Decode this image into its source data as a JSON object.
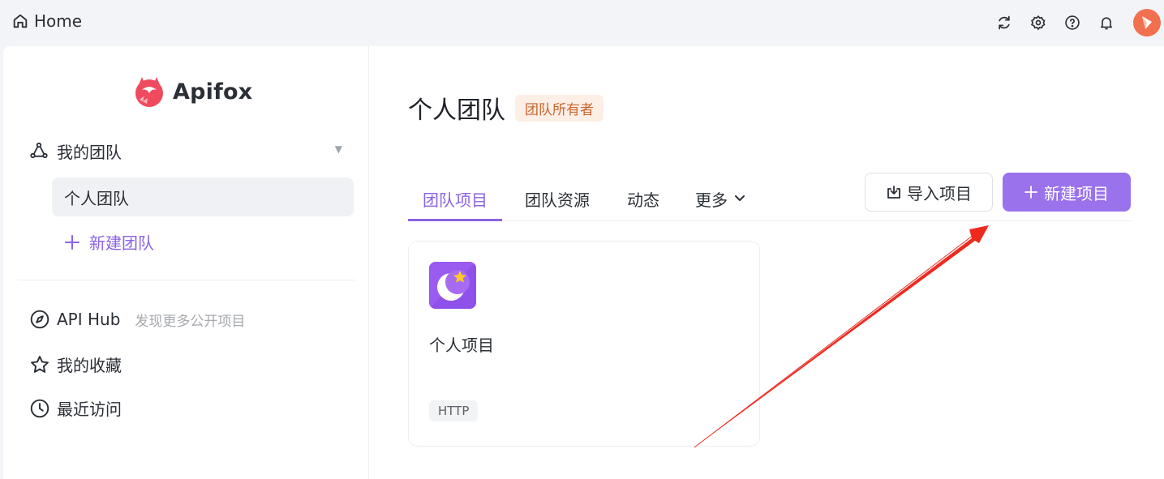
{
  "topbar": {
    "home_label": "Home",
    "icons": [
      "refresh-icon",
      "settings-icon",
      "help-icon",
      "bell-icon",
      "avatar"
    ]
  },
  "sidebar": {
    "logo_text": "Apifox",
    "team_section_label": "我的团队",
    "team_item": "个人团队",
    "new_team_label": "新建团队",
    "api_hub_label": "API Hub",
    "api_hub_sub": "发现更多公开项目",
    "favorites_label": "我的收藏",
    "recent_label": "最近访问"
  },
  "main": {
    "title": "个人团队",
    "owner_badge": "团队所有者",
    "tabs": [
      {
        "label": "团队项目",
        "active": true
      },
      {
        "label": "团队资源",
        "active": false
      },
      {
        "label": "动态",
        "active": false
      },
      {
        "label": "更多",
        "active": false
      }
    ],
    "import_button": "导入项目",
    "new_button": "新建项目",
    "project_card": {
      "name": "个人项目",
      "tag": "HTTP"
    }
  },
  "colors": {
    "accent": "#8b63e6",
    "primary_button": "#9a72ec",
    "badge_bg": "#fdeee6",
    "badge_text": "#c9652d",
    "annotation_arrow": "#ee2a1f"
  }
}
